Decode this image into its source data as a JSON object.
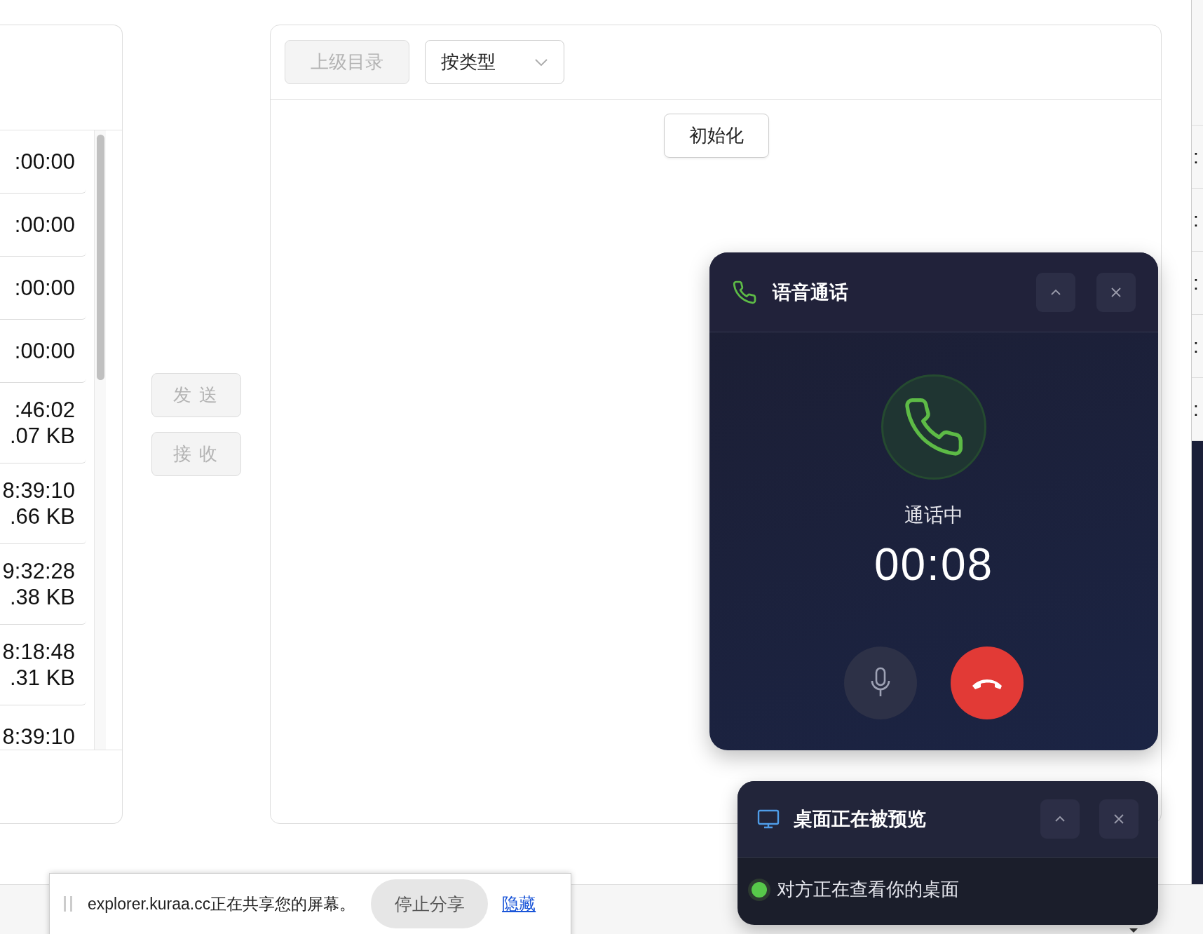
{
  "file_list": {
    "rows": [
      {
        "time": ":00:00"
      },
      {
        "time": ":00:00"
      },
      {
        "time": ":00:00"
      },
      {
        "time": ":00:00"
      },
      {
        "time": ":46:02",
        "size": ".07 KB"
      },
      {
        "time": "8:39:10",
        "size": ".66 KB"
      },
      {
        "time": "9:32:28",
        "size": ".38 KB"
      },
      {
        "time": "8:18:48",
        "size": ".31 KB"
      },
      {
        "time": "8:39:10"
      }
    ]
  },
  "transfer_buttons": [
    {
      "label": "发 送",
      "disabled": true
    },
    {
      "label": "接 收",
      "disabled": true
    }
  ],
  "explorer": {
    "up_button": {
      "label": "上级目录",
      "disabled": true
    },
    "sort_select": {
      "value": "按类型"
    },
    "init_button": {
      "label": "初始化"
    }
  },
  "voice_call": {
    "title": "语音通话",
    "status": "通话中",
    "duration": "00:08",
    "muted": false
  },
  "screen_preview": {
    "title": "桌面正在被预览",
    "message": "对方正在查看你的桌面"
  },
  "share_bar": {
    "message": "explorer.kuraa.cc正在共享您的屏幕。",
    "stop_button": "停止分享",
    "hide_link": "隐藏"
  },
  "background": {
    "right_list": [
      ":",
      ":",
      ":",
      ":",
      ":"
    ]
  }
}
